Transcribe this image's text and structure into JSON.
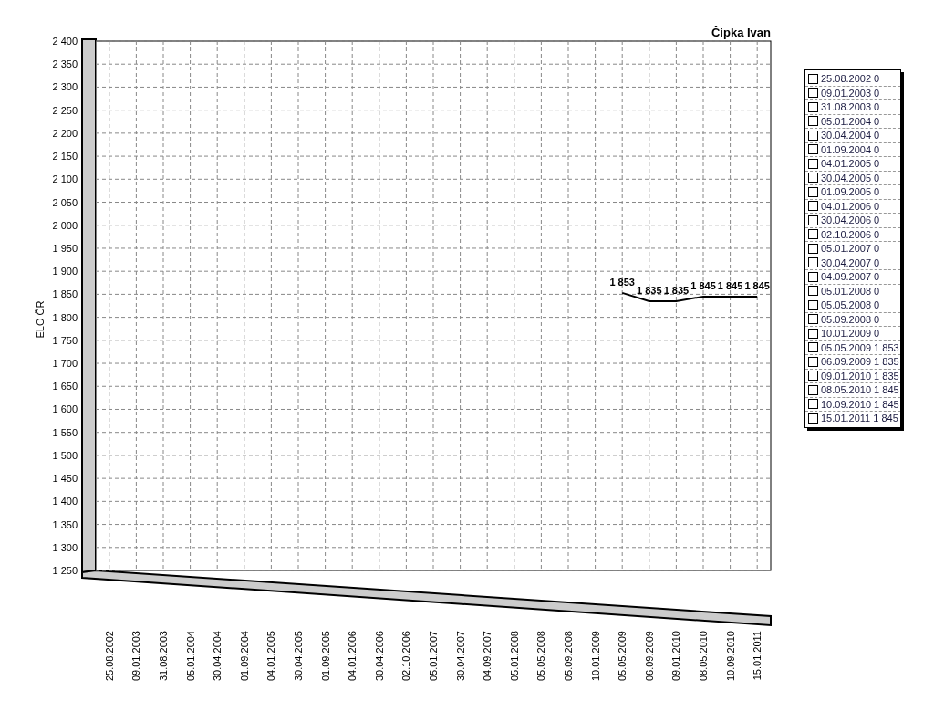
{
  "chart_data": {
    "type": "line",
    "title": "Čipka Ivan",
    "ylabel": "ELO ČR",
    "categories": [
      "25.08.2002",
      "09.01.2003",
      "31.08.2003",
      "05.01.2004",
      "30.04.2004",
      "01.09.2004",
      "04.01.2005",
      "30.04.2005",
      "01.09.2005",
      "04.01.2006",
      "30.04.2006",
      "02.10.2006",
      "05.01.2007",
      "30.04.2007",
      "04.09.2007",
      "05.01.2008",
      "05.05.2008",
      "05.09.2008",
      "10.01.2009",
      "05.05.2009",
      "06.09.2009",
      "09.01.2010",
      "08.05.2010",
      "10.09.2010",
      "15.01.2011"
    ],
    "series": [
      {
        "color": "#000000",
        "values": [
          null,
          null,
          null,
          null,
          null,
          null,
          null,
          null,
          null,
          null,
          null,
          null,
          null,
          null,
          null,
          null,
          null,
          null,
          null,
          1853,
          1835,
          1835,
          1845,
          1845,
          1845
        ]
      }
    ],
    "grid": true,
    "value_labels": [
      null,
      null,
      null,
      null,
      null,
      null,
      null,
      null,
      null,
      null,
      null,
      null,
      null,
      null,
      null,
      null,
      null,
      null,
      null,
      "1 853",
      "1 835",
      "1 835",
      "1 845",
      "1 845",
      "1 845"
    ],
    "ylim": [
      1250,
      2400
    ],
    "yticks": [
      {
        "value": 1250,
        "label": "1 250"
      },
      {
        "value": 1300,
        "label": "1 300"
      },
      {
        "value": 1350,
        "label": "1 350"
      },
      {
        "value": 1400,
        "label": "1 400"
      },
      {
        "value": 1450,
        "label": "1 450"
      },
      {
        "value": 1500,
        "label": "1 500"
      },
      {
        "value": 1550,
        "label": "1 550"
      },
      {
        "value": 1600,
        "label": "1 600"
      },
      {
        "value": 1650,
        "label": "1 650"
      },
      {
        "value": 1700,
        "label": "1 700"
      },
      {
        "value": 1750,
        "label": "1 750"
      },
      {
        "value": 1800,
        "label": "1 800"
      },
      {
        "value": 1850,
        "label": "1 850"
      },
      {
        "value": 1900,
        "label": "1 900"
      },
      {
        "value": 1950,
        "label": "1 950"
      },
      {
        "value": 2000,
        "label": "2 000"
      },
      {
        "value": 2050,
        "label": "2 050"
      },
      {
        "value": 2100,
        "label": "2 100"
      },
      {
        "value": 2150,
        "label": "2 150"
      },
      {
        "value": 2200,
        "label": "2 200"
      },
      {
        "value": 2250,
        "label": "2 250"
      },
      {
        "value": 2300,
        "label": "2 300"
      },
      {
        "value": 2350,
        "label": "2 350"
      },
      {
        "value": 2400,
        "label": "2 400"
      }
    ]
  },
  "legend": [
    {
      "label": "25.08.2002 0",
      "checked": false
    },
    {
      "label": "09.01.2003 0",
      "checked": false
    },
    {
      "label": "31.08.2003 0",
      "checked": false
    },
    {
      "label": "05.01.2004 0",
      "checked": false
    },
    {
      "label": "30.04.2004 0",
      "checked": false
    },
    {
      "label": "01.09.2004 0",
      "checked": false
    },
    {
      "label": "04.01.2005 0",
      "checked": false
    },
    {
      "label": "30.04.2005 0",
      "checked": false
    },
    {
      "label": "01.09.2005 0",
      "checked": false
    },
    {
      "label": "04.01.2006 0",
      "checked": false
    },
    {
      "label": "30.04.2006 0",
      "checked": false
    },
    {
      "label": "02.10.2006 0",
      "checked": false
    },
    {
      "label": "05.01.2007 0",
      "checked": false
    },
    {
      "label": "30.04.2007 0",
      "checked": false
    },
    {
      "label": "04.09.2007 0",
      "checked": false
    },
    {
      "label": "05.01.2008 0",
      "checked": false
    },
    {
      "label": "05.05.2008 0",
      "checked": false
    },
    {
      "label": "05.09.2008 0",
      "checked": false
    },
    {
      "label": "10.01.2009 0",
      "checked": false
    },
    {
      "label": "05.05.2009 1 853",
      "checked": false
    },
    {
      "label": "06.09.2009 1 835",
      "checked": false
    },
    {
      "label": "09.01.2010 1 835",
      "checked": false
    },
    {
      "label": "08.05.2010 1 845",
      "checked": false
    },
    {
      "label": "10.09.2010 1 845",
      "checked": false
    },
    {
      "label": "15.01.2011 1 845",
      "checked": false
    }
  ]
}
